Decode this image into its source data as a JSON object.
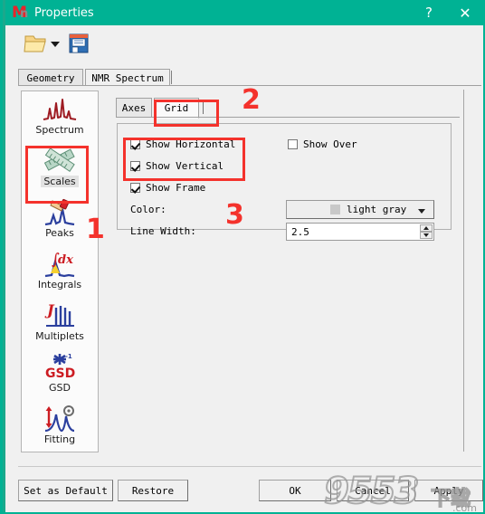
{
  "window": {
    "title": "Properties",
    "app_icon": "mnova-logo-icon",
    "help_glyph": "?",
    "close_glyph": "✕",
    "accent_color": "#00b294"
  },
  "toolbar": {
    "open_icon": "open-folder-icon",
    "open_dropdown_icon": "chevron-down-icon",
    "save_icon": "floppy-disk-save-icon"
  },
  "outer_tabs": [
    {
      "label": "Geometry",
      "selected": false
    },
    {
      "label": "NMR Spectrum",
      "selected": true
    }
  ],
  "sidebar": {
    "items": [
      {
        "label": "Spectrum",
        "icon": "spectrum-peaks-icon",
        "selected": false
      },
      {
        "label": "Scales",
        "icon": "crossed-rulers-icon",
        "selected": true
      },
      {
        "label": "Peaks",
        "icon": "peak-picking-hand-icon",
        "selected": false
      },
      {
        "label": "Integrals",
        "icon": "integral-dx-icon",
        "selected": false
      },
      {
        "label": "Multiplets",
        "icon": "j-multiplets-icon",
        "selected": false
      },
      {
        "label": "GSD",
        "icon": "gsd-star-icon",
        "selected": false
      },
      {
        "label": "Fitting",
        "icon": "fitting-gear-icon",
        "selected": false
      }
    ]
  },
  "inner_tabs": [
    {
      "label": "Axes",
      "selected": false
    },
    {
      "label": "Grid",
      "selected": true
    }
  ],
  "grid_panel": {
    "checkboxes": [
      {
        "label": "Show Horizontal",
        "checked": true
      },
      {
        "label": "Show Vertical",
        "checked": true
      },
      {
        "label": "Show Frame",
        "checked": true
      },
      {
        "label": "Show Over",
        "checked": false
      }
    ],
    "color": {
      "label": "Color:",
      "value": "light gray",
      "swatch_color": "#c8c8c8",
      "dropdown_icon": "chevron-down-icon"
    },
    "line_width": {
      "label": "Line Width:",
      "value": "2.5",
      "spin_up_icon": "spin-up-icon",
      "spin_down_icon": "spin-down-icon"
    }
  },
  "buttons": {
    "set_as_default": "Set as Default",
    "restore": "Restore",
    "ok": "OK",
    "cancel": "Cancel",
    "apply": "Apply"
  },
  "annotations": {
    "one": "1",
    "two": "2",
    "three": "3",
    "highlight_color": "#f4322c"
  },
  "watermark": {
    "digits": "9553",
    "chinese": "下载",
    "domain": ".com"
  }
}
